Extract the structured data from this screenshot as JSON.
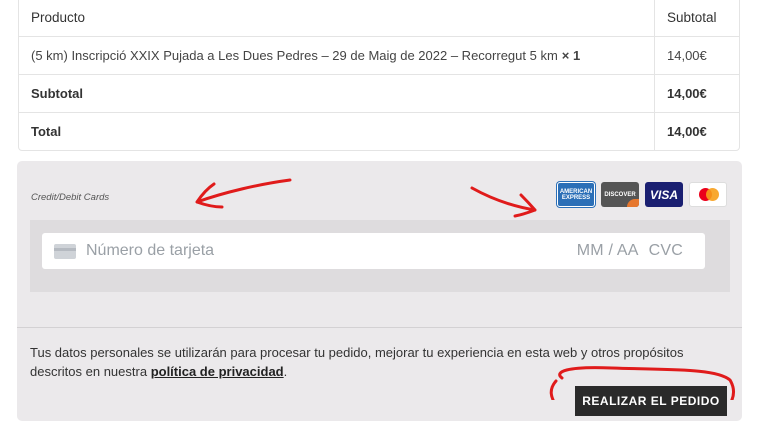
{
  "order": {
    "head_product": "Producto",
    "head_subtotal": "Subtotal",
    "item_name": "(5 km) Inscripció XXIX Pujada a Les Dues Pedres – 29 de Maig de 2022 – Recorregut 5 km",
    "item_qty": "× 1",
    "item_price": "14,00€",
    "subtotal_label": "Subtotal",
    "subtotal_value": "14,00€",
    "total_label": "Total",
    "total_value": "14,00€"
  },
  "payment": {
    "method_label": "Credit/Debit Cards",
    "cards": {
      "amex": "AMERICAN EXPRESS",
      "discover": "DISCOVER",
      "visa": "VISA",
      "mastercard": "mastercard"
    },
    "card_number_placeholder": "Número de tarjeta",
    "expiry_placeholder": "MM / AA",
    "cvc_placeholder": "CVC"
  },
  "privacy": {
    "text": "Tus datos personales se utilizarán para procesar tu pedido, mejorar tu experiencia en esta web y otros propósitos descritos en nuestra ",
    "link": "política de privacidad",
    "end": "."
  },
  "button": {
    "place_order": "REALIZAR EL PEDIDO"
  },
  "annotation_color": "#e01b1b"
}
